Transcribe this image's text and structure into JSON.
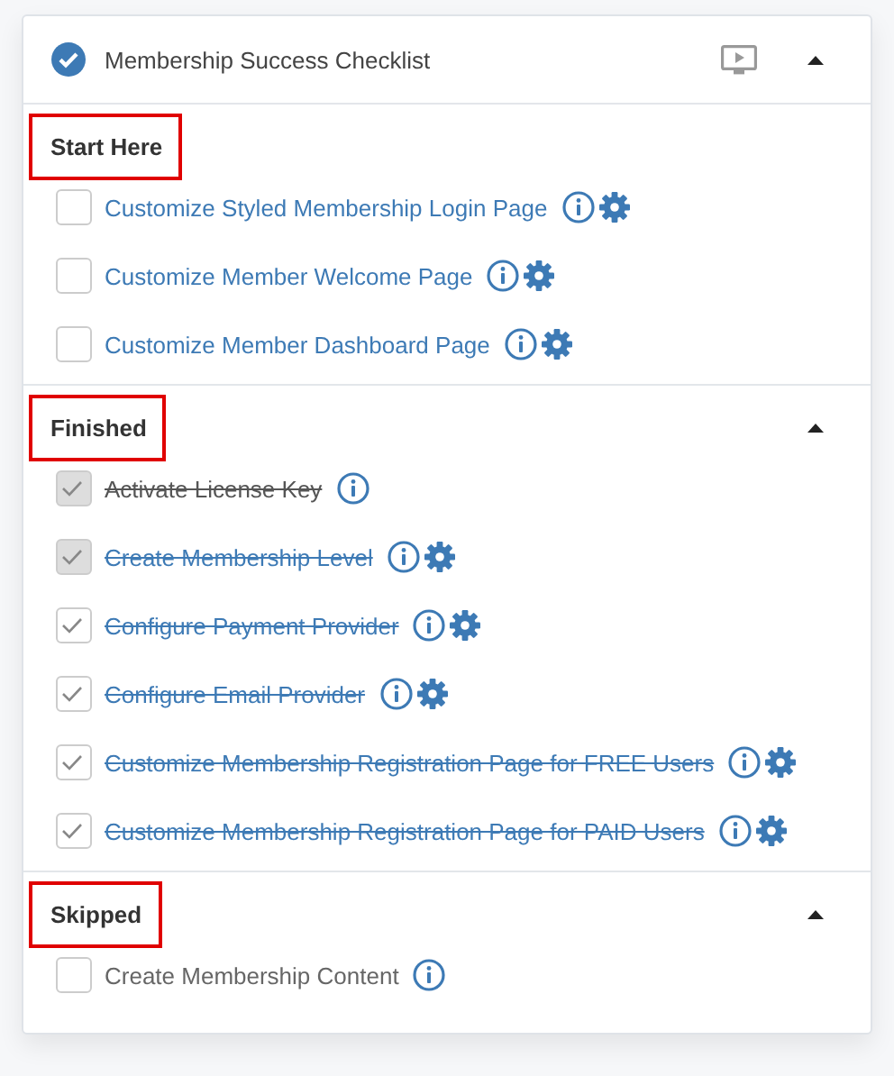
{
  "header": {
    "title": "Membership Success Checklist",
    "expanded": true
  },
  "sections": [
    {
      "title": "Start Here",
      "highlighted": true,
      "items": [
        {
          "label": "Customize Styled Membership Login Page",
          "checked": false,
          "disabled": false,
          "link": true,
          "has_settings": true
        },
        {
          "label": "Customize Member Welcome Page",
          "checked": false,
          "disabled": false,
          "link": true,
          "has_settings": true
        },
        {
          "label": "Customize Member Dashboard Page",
          "checked": false,
          "disabled": false,
          "link": true,
          "has_settings": true
        }
      ]
    },
    {
      "title": "Finished",
      "highlighted": true,
      "expanded": true,
      "items": [
        {
          "label": "Activate License Key",
          "checked": true,
          "disabled": true,
          "link": false,
          "has_settings": false
        },
        {
          "label": "Create Membership Level",
          "checked": true,
          "disabled": true,
          "link": true,
          "has_settings": true
        },
        {
          "label": "Configure Payment Provider",
          "checked": true,
          "disabled": false,
          "link": true,
          "has_settings": true
        },
        {
          "label": "Configure Email Provider",
          "checked": true,
          "disabled": false,
          "link": true,
          "has_settings": true
        },
        {
          "label": "Customize Membership Registration Page for FREE Users",
          "checked": true,
          "disabled": false,
          "link": true,
          "has_settings": true
        },
        {
          "label": "Customize Membership Registration Page for PAID Users",
          "checked": true,
          "disabled": false,
          "link": true,
          "has_settings": true
        }
      ]
    },
    {
      "title": "Skipped",
      "highlighted": true,
      "expanded": true,
      "items": [
        {
          "label": "Create Membership Content",
          "checked": false,
          "disabled": false,
          "link": false,
          "has_settings": false
        }
      ]
    }
  ]
}
